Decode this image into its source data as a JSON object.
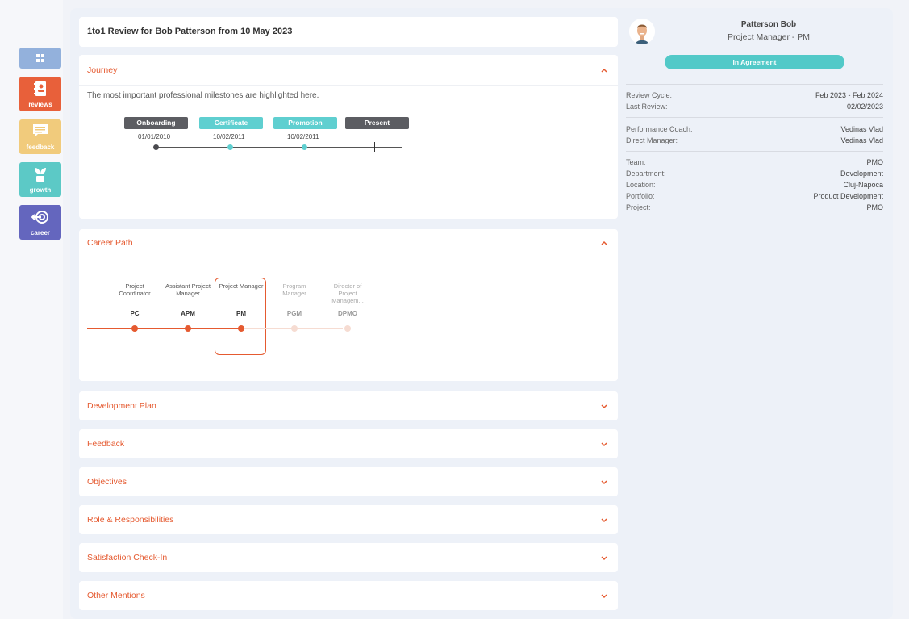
{
  "nav": {
    "items": [
      {
        "label": "",
        "icon": "dashboard-icon",
        "color": "#93b1dc"
      },
      {
        "label": "reviews",
        "icon": "reviews-book-icon",
        "color": "#e8603a"
      },
      {
        "label": "feedback",
        "icon": "feedback-chat-icon",
        "color": "#f1cb7c"
      },
      {
        "label": "growth",
        "icon": "growth-plant-icon",
        "color": "#5cc9c6"
      },
      {
        "label": "career",
        "icon": "career-target-icon",
        "color": "#6466be"
      }
    ]
  },
  "title": "1to1 Review for Bob Patterson from 10 May 2023",
  "journey": {
    "title": "Journey",
    "description": "The most important professional milestones are highlighted here.",
    "milestones": [
      {
        "label": "Onboarding",
        "date": "01/01/2010",
        "style": "dark"
      },
      {
        "label": "Certificate",
        "date": "10/02/2011",
        "style": "teal"
      },
      {
        "label": "Promotion",
        "date": "10/02/2011",
        "style": "teal"
      },
      {
        "label": "Present",
        "date": "",
        "style": "dark"
      }
    ]
  },
  "career_path": {
    "title": "Career Path",
    "roles": [
      {
        "name": "Project Coordinator",
        "abbr": "PC",
        "state": "done"
      },
      {
        "name": "Assistant Project Manager",
        "abbr": "APM",
        "state": "done"
      },
      {
        "name": "Project Manager",
        "abbr": "PM",
        "state": "current"
      },
      {
        "name": "Program Manager",
        "abbr": "PGM",
        "state": "future"
      },
      {
        "name": "Director of Project Managem...",
        "abbr": "DPMO",
        "state": "future"
      }
    ]
  },
  "sections": [
    {
      "title": "Development Plan"
    },
    {
      "title": "Feedback"
    },
    {
      "title": "Objectives"
    },
    {
      "title": "Role & Responsibilities"
    },
    {
      "title": "Satisfaction Check-In"
    },
    {
      "title": "Other Mentions"
    }
  ],
  "profile": {
    "name": "Patterson Bob",
    "role": "Project Manager - PM",
    "status": "In Agreement",
    "review_cycle_label": "Review Cycle:",
    "review_cycle": "Feb 2023 - Feb 2024",
    "last_review_label": "Last Review:",
    "last_review": "02/02/2023",
    "coach_label": "Performance Coach:",
    "coach": "Vedinas Vlad",
    "manager_label": "Direct Manager:",
    "manager": "Vedinas Vlad",
    "team_label": "Team:",
    "team": "PMO",
    "department_label": "Department:",
    "department": "Development",
    "location_label": "Location:",
    "location": "Cluj-Napoca",
    "portfolio_label": "Portfolio:",
    "portfolio": "Product Development",
    "project_label": "Project:",
    "project": "PMO"
  },
  "colors": {
    "accent": "#e55a30",
    "teal": "#5fcfd0",
    "dark": "#5c5d62"
  }
}
